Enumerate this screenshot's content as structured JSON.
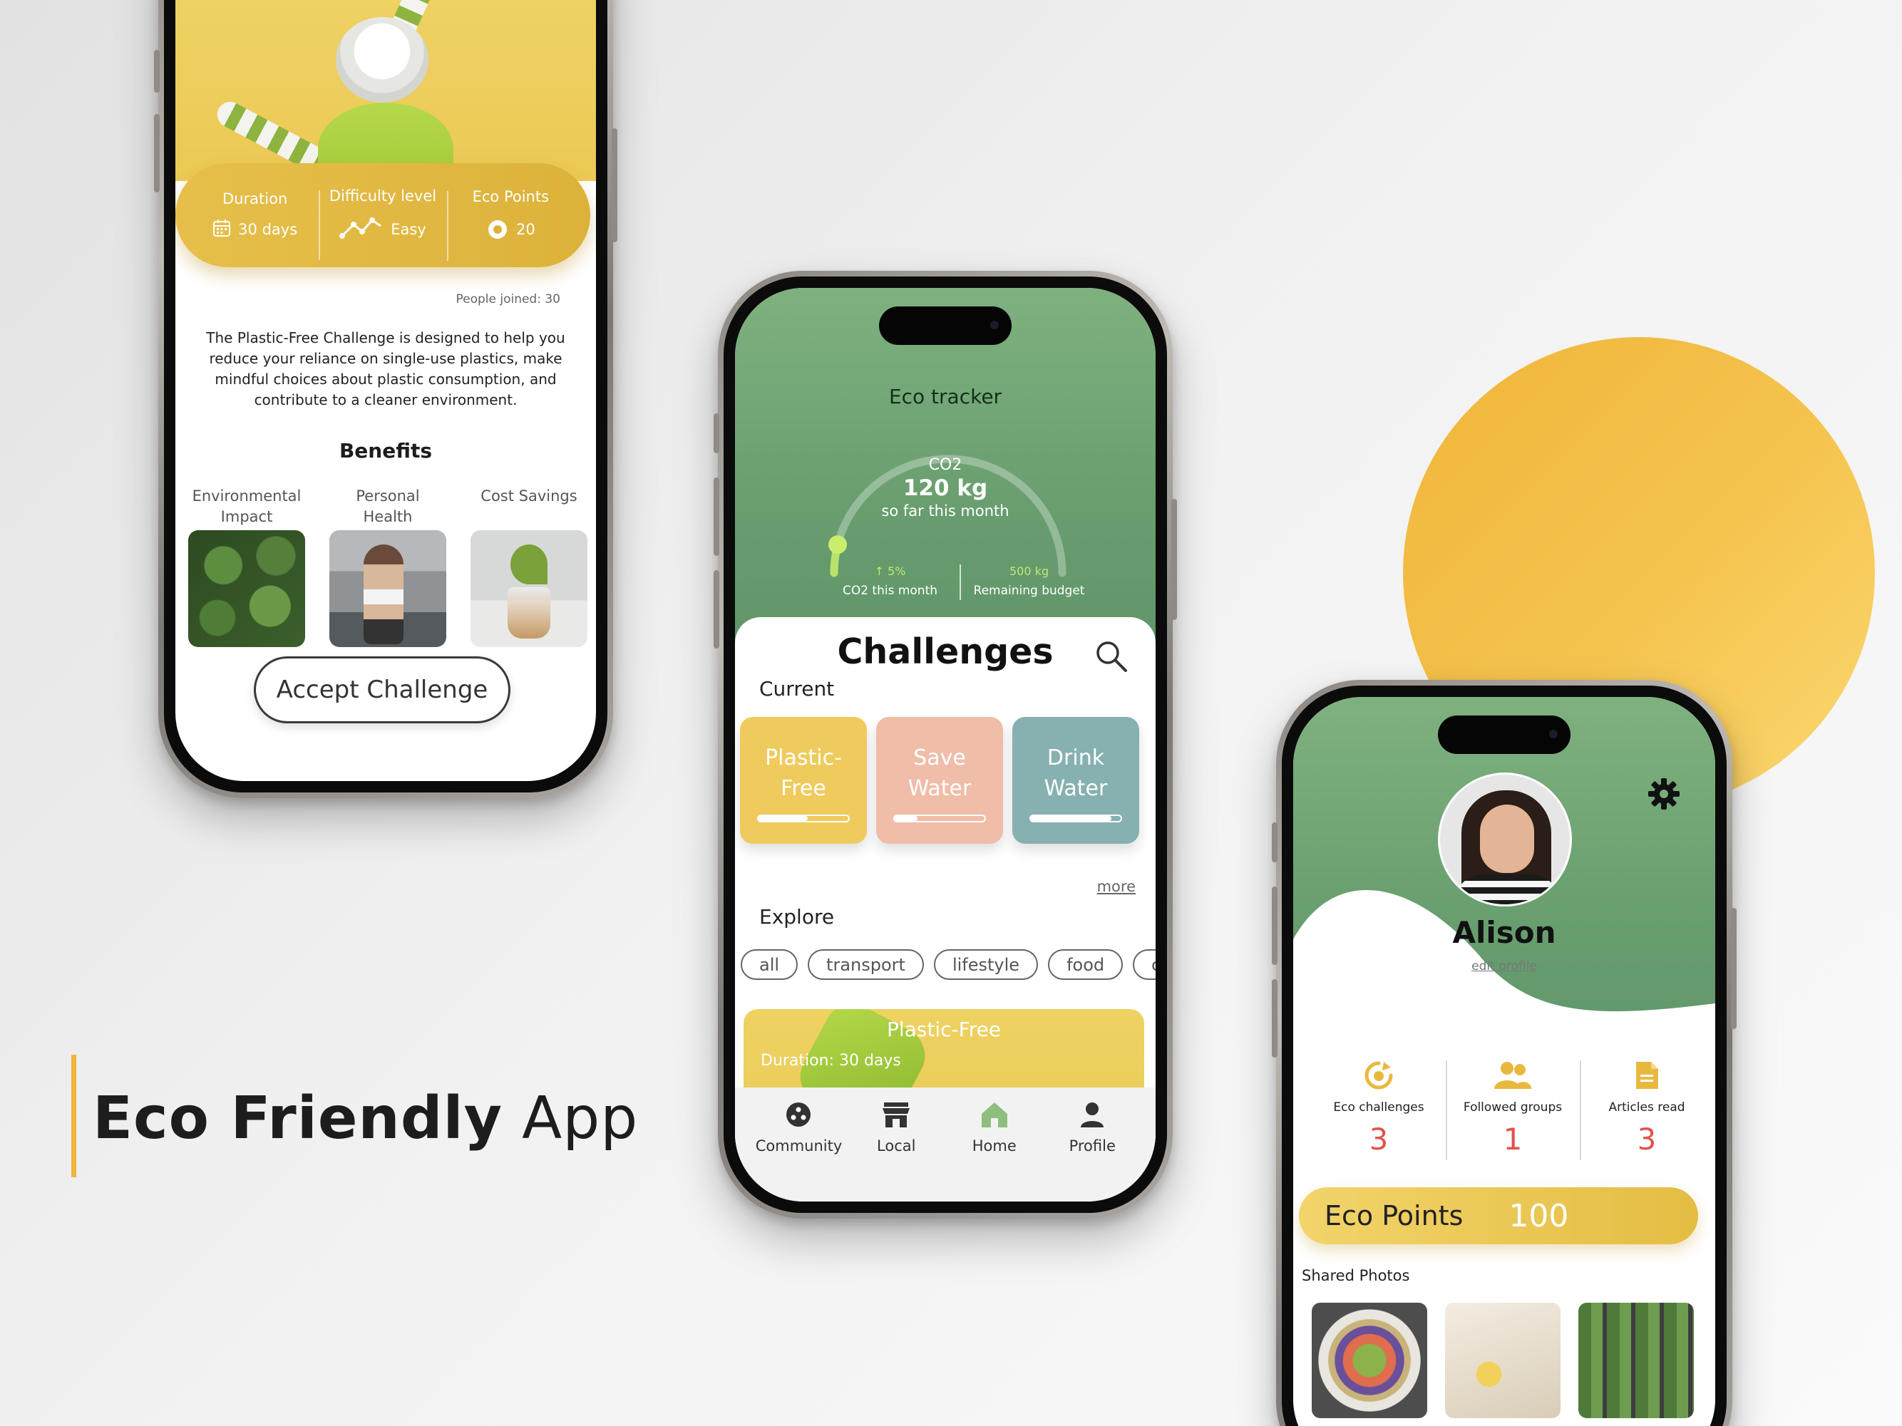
{
  "brand": {
    "title_bold": "Eco Friendly",
    "title_light": "App"
  },
  "colors": {
    "accent_yellow": "#f0b53a",
    "green": "#6aa070",
    "red_value": "#e0534a"
  },
  "challenge_detail": {
    "stats": [
      {
        "label": "Duration",
        "value": "30 days",
        "icon": "calendar-icon"
      },
      {
        "label": "Difficulty level",
        "value": "Easy",
        "icon": "trend-icon"
      },
      {
        "label": "Eco Points",
        "value": "20",
        "icon": "coin-icon"
      }
    ],
    "people_joined": "People joined: 30",
    "description": "The Plastic-Free Challenge is designed to help you reduce your reliance on single-use plastics, make mindful choices about plastic consumption, and contribute to a cleaner environment.",
    "benefits_title": "Benefits",
    "benefits": [
      {
        "label": "Environmental Impact"
      },
      {
        "label": "Personal Health"
      },
      {
        "label": "Cost Savings"
      }
    ],
    "accept_button": "Accept Challenge"
  },
  "home": {
    "tracker_title": "Eco tracker",
    "gauge": {
      "label": "CO2",
      "value": "120 kg",
      "caption": "so far this month",
      "fraction": 0.08
    },
    "kpis": [
      {
        "value": "↑ 5%",
        "label": "CO2 this month"
      },
      {
        "value": "500 kg",
        "label": "Remaining budget"
      }
    ],
    "challenges_title": "Challenges",
    "current_label": "Current",
    "current_cards": [
      {
        "line1": "Plastic-",
        "line2": "Free",
        "progress": 0.55,
        "color": "#efcb5d"
      },
      {
        "line1": "Save",
        "line2": "Water",
        "progress": 0.25,
        "color": "#f0bda9"
      },
      {
        "line1": "Drink",
        "line2": "Water",
        "progress": 0.9,
        "color": "#86b1b0"
      }
    ],
    "more_link": "more",
    "explore_label": "Explore",
    "chips": [
      "all",
      "transport",
      "lifestyle",
      "food",
      "cl"
    ],
    "featured": {
      "title": "Plastic-Free",
      "subtitle": "Duration: 30 days"
    },
    "nav": [
      {
        "label": "Community",
        "icon": "community-icon"
      },
      {
        "label": "Local",
        "icon": "store-icon"
      },
      {
        "label": "Home",
        "icon": "home-icon"
      },
      {
        "label": "Profile",
        "icon": "profile-icon"
      }
    ]
  },
  "profile": {
    "name": "Alison",
    "edit_link": "edit profile",
    "stats": [
      {
        "label": "Eco challenges",
        "value": "3",
        "icon": "challenge-icon"
      },
      {
        "label": "Followed groups",
        "value": "1",
        "icon": "groups-icon"
      },
      {
        "label": "Articles read",
        "value": "3",
        "icon": "article-icon"
      }
    ],
    "eco_points_label": "Eco Points",
    "eco_points_value": "100",
    "shared_photos_label": "Shared Photos"
  }
}
